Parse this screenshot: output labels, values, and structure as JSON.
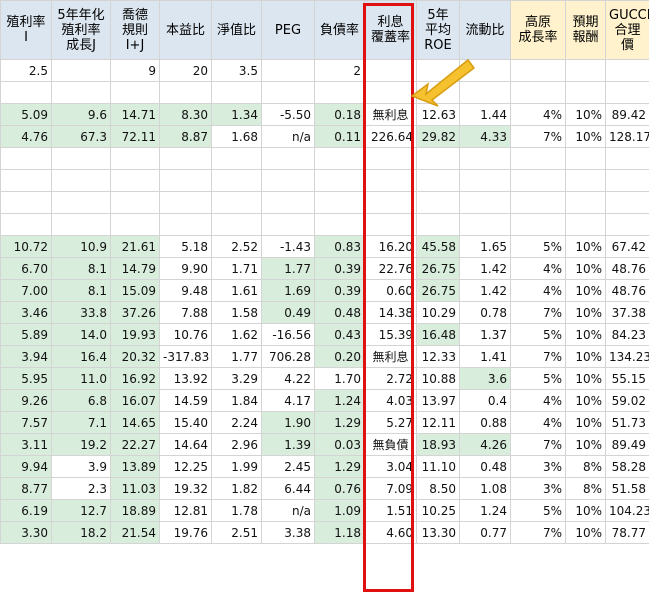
{
  "sheet": {
    "headers": [
      "殖利率\nI",
      "5年年化\n殖利率\n成長J",
      "喬德\n規則\nI+J",
      "本益比",
      "淨值比",
      "PEG",
      "負債率",
      "利息\n覆蓋率",
      "5年\n平均\nROE",
      "流動比",
      "高原\n成長率",
      "預期\n報酬",
      "GUCCI\n合理價"
    ],
    "rows": [
      [
        "2.5",
        "",
        "9",
        "20",
        "3.5",
        "",
        "2",
        "",
        "",
        "",
        "",
        "",
        ""
      ],
      [
        "",
        "",
        "",
        "",
        "",
        "",
        "",
        "",
        "",
        "",
        "",
        "",
        ""
      ],
      [
        "5.09",
        "9.6",
        "14.71",
        "8.30",
        "1.34",
        "-5.50",
        "0.18",
        "無利息",
        "12.63",
        "1.44",
        "4%",
        "10%",
        "89.42"
      ],
      [
        "4.76",
        "67.3",
        "72.11",
        "8.87",
        "1.68",
        "n/a",
        "0.11",
        "226.64",
        "29.82",
        "4.33",
        "7%",
        "10%",
        "128.17"
      ],
      [
        "",
        "",
        "",
        "",
        "",
        "",
        "",
        "",
        "",
        "",
        "",
        "",
        ""
      ],
      [
        "",
        "",
        "",
        "",
        "",
        "",
        "",
        "",
        "",
        "",
        "",
        "",
        ""
      ],
      [
        "",
        "",
        "",
        "",
        "",
        "",
        "",
        "",
        "",
        "",
        "",
        "",
        ""
      ],
      [
        "",
        "",
        "",
        "",
        "",
        "",
        "",
        "",
        "",
        "",
        "",
        "",
        ""
      ],
      [
        "10.72",
        "10.9",
        "21.61",
        "5.18",
        "2.52",
        "-1.43",
        "0.83",
        "16.20",
        "45.58",
        "1.65",
        "5%",
        "10%",
        "67.42"
      ],
      [
        "6.70",
        "8.1",
        "14.79",
        "9.90",
        "1.71",
        "1.77",
        "0.39",
        "22.76",
        "26.75",
        "1.42",
        "4%",
        "10%",
        "48.76"
      ],
      [
        "7.00",
        "8.1",
        "15.09",
        "9.48",
        "1.61",
        "1.69",
        "0.39",
        "0.60",
        "26.75",
        "1.42",
        "4%",
        "10%",
        "48.76"
      ],
      [
        "3.46",
        "33.8",
        "37.26",
        "7.88",
        "1.58",
        "0.49",
        "0.48",
        "14.38",
        "10.29",
        "0.78",
        "7%",
        "10%",
        "37.38"
      ],
      [
        "5.89",
        "14.0",
        "19.93",
        "10.76",
        "1.62",
        "-16.56",
        "0.43",
        "15.39",
        "16.48",
        "1.37",
        "5%",
        "10%",
        "84.23"
      ],
      [
        "3.94",
        "16.4",
        "20.32",
        "-317.83",
        "1.77",
        "706.28",
        "0.20",
        "無利息",
        "12.33",
        "1.41",
        "7%",
        "10%",
        "134.23"
      ],
      [
        "5.95",
        "11.0",
        "16.92",
        "13.92",
        "3.29",
        "4.22",
        "1.70",
        "2.72",
        "10.88",
        "3.6",
        "5%",
        "10%",
        "55.15"
      ],
      [
        "9.26",
        "6.8",
        "16.07",
        "14.59",
        "1.84",
        "4.17",
        "1.24",
        "4.03",
        "13.97",
        "0.4",
        "4%",
        "10%",
        "59.02"
      ],
      [
        "7.57",
        "7.1",
        "14.65",
        "15.40",
        "2.24",
        "1.90",
        "1.29",
        "5.27",
        "12.11",
        "0.88",
        "4%",
        "10%",
        "51.73"
      ],
      [
        "3.11",
        "19.2",
        "22.27",
        "14.64",
        "2.96",
        "1.39",
        "0.03",
        "無負債",
        "18.93",
        "4.26",
        "7%",
        "10%",
        "89.49"
      ],
      [
        "9.94",
        "3.9",
        "13.89",
        "12.25",
        "1.99",
        "2.45",
        "1.29",
        "3.04",
        "11.10",
        "0.48",
        "3%",
        "8%",
        "58.28"
      ],
      [
        "8.77",
        "2.3",
        "11.03",
        "19.32",
        "1.82",
        "6.44",
        "0.76",
        "7.09",
        "8.50",
        "1.08",
        "3%",
        "8%",
        "51.58"
      ],
      [
        "6.19",
        "12.7",
        "18.89",
        "12.81",
        "1.78",
        "n/a",
        "1.09",
        "1.51",
        "10.25",
        "1.24",
        "5%",
        "10%",
        "104.23"
      ],
      [
        "3.30",
        "18.2",
        "21.54",
        "19.76",
        "2.51",
        "3.38",
        "1.18",
        "4.60",
        "13.30",
        "0.77",
        "7%",
        "10%",
        "78.77"
      ]
    ],
    "green_cells": [
      [
        2,
        0
      ],
      [
        2,
        1
      ],
      [
        2,
        2
      ],
      [
        2,
        3
      ],
      [
        2,
        4
      ],
      [
        2,
        6
      ],
      [
        3,
        0
      ],
      [
        3,
        1
      ],
      [
        3,
        2
      ],
      [
        3,
        3
      ],
      [
        3,
        6
      ],
      [
        3,
        8
      ],
      [
        3,
        9
      ],
      [
        8,
        0
      ],
      [
        8,
        1
      ],
      [
        8,
        2
      ],
      [
        8,
        6
      ],
      [
        8,
        8
      ],
      [
        9,
        0
      ],
      [
        9,
        1
      ],
      [
        9,
        2
      ],
      [
        9,
        5
      ],
      [
        9,
        6
      ],
      [
        9,
        8
      ],
      [
        10,
        0
      ],
      [
        10,
        1
      ],
      [
        10,
        2
      ],
      [
        10,
        5
      ],
      [
        10,
        6
      ],
      [
        10,
        8
      ],
      [
        11,
        0
      ],
      [
        11,
        1
      ],
      [
        11,
        2
      ],
      [
        11,
        5
      ],
      [
        11,
        6
      ],
      [
        12,
        0
      ],
      [
        12,
        1
      ],
      [
        12,
        2
      ],
      [
        12,
        6
      ],
      [
        12,
        8
      ],
      [
        13,
        0
      ],
      [
        13,
        1
      ],
      [
        13,
        2
      ],
      [
        13,
        6
      ],
      [
        14,
        0
      ],
      [
        14,
        1
      ],
      [
        14,
        2
      ],
      [
        14,
        9
      ],
      [
        15,
        0
      ],
      [
        15,
        1
      ],
      [
        15,
        2
      ],
      [
        15,
        6
      ],
      [
        16,
        0
      ],
      [
        16,
        1
      ],
      [
        16,
        2
      ],
      [
        16,
        5
      ],
      [
        16,
        6
      ],
      [
        17,
        0
      ],
      [
        17,
        1
      ],
      [
        17,
        2
      ],
      [
        17,
        5
      ],
      [
        17,
        6
      ],
      [
        17,
        8
      ],
      [
        17,
        9
      ],
      [
        18,
        0
      ],
      [
        18,
        2
      ],
      [
        18,
        6
      ],
      [
        19,
        0
      ],
      [
        19,
        2
      ],
      [
        19,
        6
      ],
      [
        20,
        0
      ],
      [
        20,
        1
      ],
      [
        20,
        2
      ],
      [
        20,
        6
      ],
      [
        21,
        0
      ],
      [
        21,
        1
      ],
      [
        21,
        2
      ],
      [
        21,
        6
      ]
    ],
    "header_fill": "#dce6f1",
    "header_highlight_fill": "#fff2cc",
    "green_fill": "#d8eddc",
    "highlight_border_color": "#e01010",
    "arrow_color": "#f5c12e",
    "arrow_icon": "pointer-arrow-icon"
  }
}
